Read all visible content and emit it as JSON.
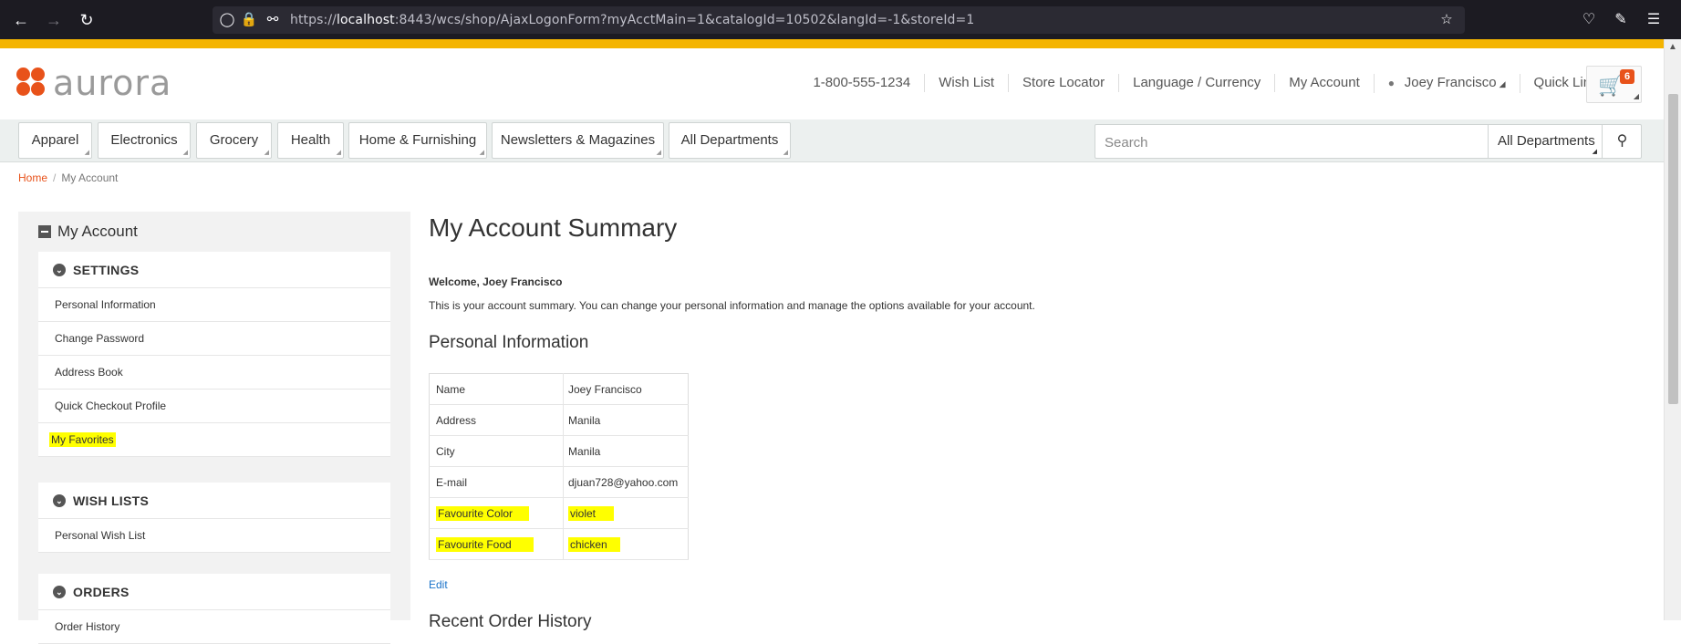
{
  "browser": {
    "url_prefix": "https://",
    "url_host": "localhost",
    "url_rest": ":8443/wcs/shop/AjaxLogonForm?myAcctMain=1&catalogId=10502&langId=-1&storeId=1"
  },
  "header": {
    "logo_text": "aurora",
    "phone": "1-800-555-1234",
    "wish_list": "Wish List",
    "store_locator": "Store Locator",
    "language_currency": "Language / Currency",
    "my_account": "My Account",
    "user_name": "Joey Francisco",
    "quick_links": "Quick Links",
    "cart_count": "6"
  },
  "nav": {
    "departments": [
      "Apparel",
      "Electronics",
      "Grocery",
      "Health",
      "Home & Furnishing",
      "Newsletters & Magazines",
      "All Departments"
    ],
    "search_placeholder": "Search",
    "search_category": "All Departments"
  },
  "breadcrumb": {
    "home": "Home",
    "current": "My Account"
  },
  "sidebar": {
    "title": "My Account",
    "settings": {
      "heading": "SETTINGS",
      "items": [
        "Personal Information",
        "Change Password",
        "Address Book",
        "Quick Checkout Profile",
        "My Favorites"
      ]
    },
    "wish_lists": {
      "heading": "WISH LISTS",
      "items": [
        "Personal Wish List"
      ]
    },
    "orders": {
      "heading": "ORDERS",
      "items": [
        "Order History"
      ]
    }
  },
  "main": {
    "title": "My Account Summary",
    "welcome": "Welcome, Joey Francisco",
    "summary": "This is your account summary. You can change your personal information and manage the options available for your account.",
    "personal_info_title": "Personal Information",
    "rows": [
      {
        "label": "Name",
        "value": "Joey Francisco"
      },
      {
        "label": "Address",
        "value": "Manila"
      },
      {
        "label": "City",
        "value": "Manila"
      },
      {
        "label": "E-mail",
        "value": "djuan728@yahoo.com"
      },
      {
        "label": "Favourite Color",
        "value": "violet"
      },
      {
        "label": "Favourite Food",
        "value": "chicken"
      }
    ],
    "edit": "Edit",
    "recent_orders_title": "Recent Order History"
  },
  "colors": {
    "accent_strip": "#f4b400",
    "brand_orange": "#e8521a",
    "highlight": "#ffff00",
    "link_blue": "#1a73c9"
  }
}
